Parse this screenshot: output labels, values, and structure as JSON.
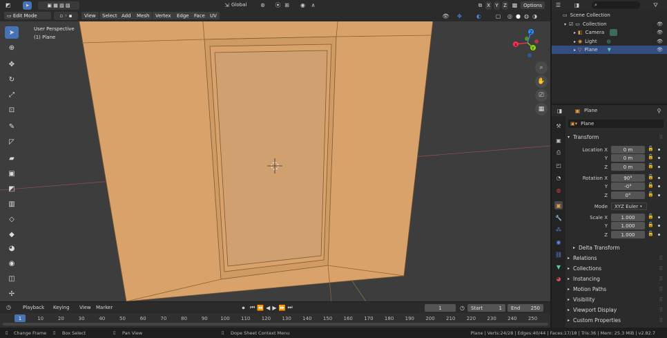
{
  "top_header": {
    "orientation": "Global",
    "axes": [
      "X",
      "Y",
      "Z"
    ],
    "options_label": "Options"
  },
  "mode_header": {
    "mode": "Edit Mode",
    "menus": [
      "View",
      "Select",
      "Add",
      "Mesh",
      "Vertex",
      "Edge",
      "Face",
      "UV"
    ]
  },
  "viewport": {
    "perspective_label": "User Perspective",
    "object_label": "(1) Plane",
    "mesh_color": "#d9a26a",
    "gizmo": {
      "x": "X",
      "y": "Y",
      "z": "Z"
    }
  },
  "timeline_header": {
    "menus": [
      "Playback",
      "Keying",
      "View",
      "Marker"
    ],
    "current_frame": "1",
    "start_label": "Start",
    "start_value": "1",
    "end_label": "End",
    "end_value": "250"
  },
  "timeline": {
    "current": "1",
    "ticks": [
      "10",
      "20",
      "30",
      "40",
      "50",
      "60",
      "70",
      "80",
      "90",
      "100",
      "110",
      "120",
      "130",
      "140",
      "150",
      "160",
      "170",
      "180",
      "190",
      "200",
      "210",
      "220",
      "230",
      "240",
      "250"
    ]
  },
  "status": {
    "change_frame": "Change Frame",
    "box_select": "Box Select",
    "pan_view": "Pan View",
    "context_menu": "Dope Sheet Context Menu",
    "stats": "Plane | Verts:24/28 | Edges:40/44 | Faces:17/18 | Tris:36 | Mem: 25.3 MiB | v2.82.7"
  },
  "outliner": {
    "scene_collection": "Scene Collection",
    "collection": "Collection",
    "items": [
      "Camera",
      "Light",
      "Plane"
    ]
  },
  "properties": {
    "object_name": "Plane",
    "name_field": "Plane",
    "transform_title": "Transform",
    "location": {
      "label_x": "Location X",
      "x": "0 m",
      "y": "0 m",
      "z": "0 m"
    },
    "rotation": {
      "label_x": "Rotation X",
      "x": "90°",
      "y": "-0°",
      "z": "0°"
    },
    "mode_label": "Mode",
    "mode_value": "XYZ Euler",
    "scale": {
      "label_x": "Scale X",
      "x": "1.000",
      "y": "1.000",
      "z": "1.000"
    },
    "axis_y": "Y",
    "axis_z": "Z",
    "delta_transform": "Delta Transform",
    "panels": [
      "Relations",
      "Collections",
      "Instancing",
      "Motion Paths",
      "Visibility",
      "Viewport Display",
      "Custom Properties"
    ]
  },
  "colors": {
    "accent": "#4772b3",
    "selection_row": "#334d80",
    "x_axis": "#ff3352",
    "y_axis": "#8bdc00",
    "z_axis": "#2890ff"
  }
}
